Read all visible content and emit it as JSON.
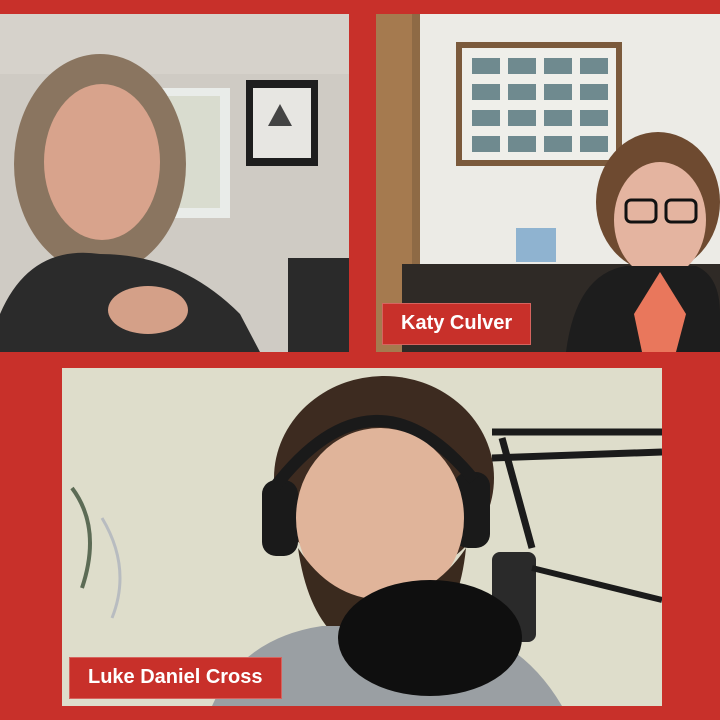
{
  "participants": [
    {
      "name": ""
    },
    {
      "name": "Katy Culver"
    },
    {
      "name": "Luke Daniel Cross"
    }
  ],
  "colors": {
    "frame": "#c8302a",
    "label_text": "#ffffff"
  }
}
